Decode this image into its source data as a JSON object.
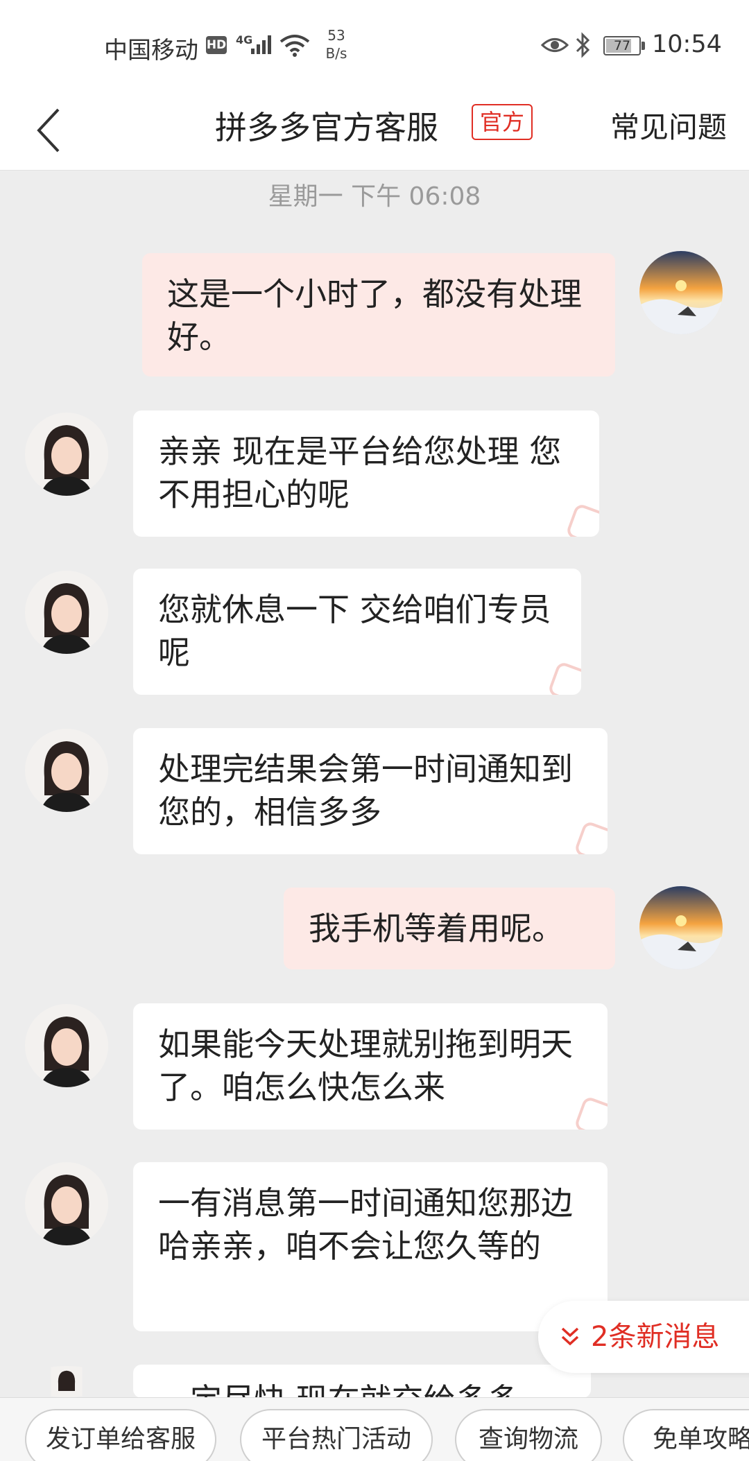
{
  "status_bar": {
    "carrier": "中国移动",
    "hd": "HD",
    "network": "4G",
    "speed_value": "53",
    "speed_unit": "B/s",
    "battery": "77",
    "time": "10:54"
  },
  "header": {
    "title": "拼多多官方客服",
    "badge": "官方",
    "faq": "常见问题"
  },
  "chat": {
    "timestamp": "星期一 下午 06:08",
    "messages": [
      {
        "from": "user",
        "text": "这是一个小时了，都没有处理好。"
      },
      {
        "from": "agent",
        "text": "亲亲 现在是平台给您处理 您不用担心的呢"
      },
      {
        "from": "agent",
        "text": "您就休息一下 交给咱们专员呢"
      },
      {
        "from": "agent",
        "text": "处理完结果会第一时间通知到您的，相信多多"
      },
      {
        "from": "user",
        "text": "我手机等着用呢。"
      },
      {
        "from": "agent",
        "text": "如果能今天处理就别拖到明天了。咱怎么快怎么来"
      },
      {
        "from": "agent",
        "text": "一有消息第一时间通知您那边哈亲亲，咱不会让您久等的"
      },
      {
        "from": "agent",
        "text": "…定尽快 现在就交给多多"
      }
    ]
  },
  "new_messages": "2条新消息",
  "quick_actions": [
    "发订单给客服",
    "平台热门活动",
    "查询物流",
    "免单攻略"
  ],
  "colors": {
    "accent": "#e02e24",
    "outgoing_bubble": "#fde9e6",
    "incoming_bubble": "#ffffff",
    "chat_background": "#ededed"
  },
  "icons": {
    "back": "chevron-left-icon",
    "new_messages": "double-chevron-down-icon",
    "watermark": "pdd-watermark-icon"
  }
}
